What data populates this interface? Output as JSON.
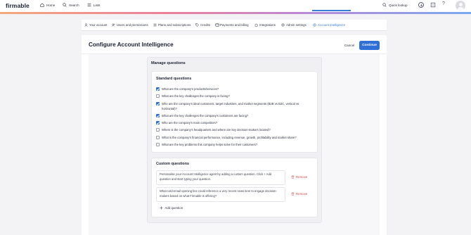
{
  "topnav": {
    "logo": "firmable",
    "home": "Home",
    "search": "Search",
    "lists": "Lists",
    "quick_lookup": "Quick lookup",
    "icons": [
      "home-icon",
      "search-icon",
      "list-icon",
      "search-icon",
      "download-icon",
      "building-icon",
      "help-icon",
      "avatar"
    ]
  },
  "tabs": [
    {
      "label": "Your account",
      "icon": "user-icon"
    },
    {
      "label": "Users and permissions",
      "icon": "users-icon"
    },
    {
      "label": "Plans and subscriptions",
      "icon": "list-icon"
    },
    {
      "label": "Credits",
      "icon": "tag-icon"
    },
    {
      "label": "Payments and billing",
      "icon": "card-icon"
    },
    {
      "label": "Integrations",
      "icon": "puzzle-icon"
    },
    {
      "label": "Admin settings",
      "icon": "gear-icon"
    },
    {
      "label": "Account intelligence",
      "icon": "sparkle-icon",
      "active": true
    }
  ],
  "header": {
    "title": "Configure Account Intelligence",
    "cancel": "Cancel",
    "continue": "Continue"
  },
  "manage": {
    "title": "Manage questions",
    "standard_title": "Standard questions",
    "standard_questions": [
      {
        "text": "What are the company's products/services?",
        "checked": true
      },
      {
        "text": "What are the key challenges the company is facing?",
        "checked": false
      },
      {
        "text": "Who are the company's ideal customers, target industries, and market segments (B2B vs B2C, vertical vs horizontal)?",
        "checked": true
      },
      {
        "text": "What are the key challenges the company's customers are facing?",
        "checked": true
      },
      {
        "text": "Who are the company's main competitors?",
        "checked": true
      },
      {
        "text": "Where is the company's headquarters and where are key decision-makers located?",
        "checked": false
      },
      {
        "text": "What is the company's financial performance, including revenue, growth, profitability and market share?",
        "checked": false
      },
      {
        "text": "What are the key problems this company helps solve for their customers?",
        "checked": false
      }
    ],
    "custom_title": "Custom questions",
    "custom_questions": [
      {
        "text": "Personalise your Account Intelligence agent by adding a custom question. Click + Add question and start typing your question.",
        "remove": "Remove"
      },
      {
        "text": "What cold-email opening line could reference a very recent news item to engage decision-makers based on what Firmable is offering?",
        "remove": "Remove"
      }
    ],
    "add_question": "Add question"
  },
  "colors": {
    "accent": "#2f6fd6",
    "danger": "#d9463e"
  }
}
